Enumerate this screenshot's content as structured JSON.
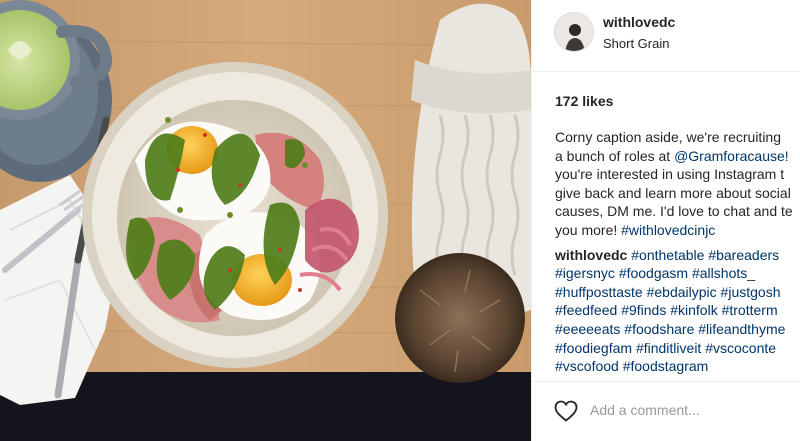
{
  "post": {
    "username": "withlovedc",
    "location": "Short Grain",
    "likes_text": "172 likes",
    "caption": {
      "l1": "Corny caption aside, we're recruiting",
      "l2a": "a bunch of roles at ",
      "l2_mention": "@Gramforacause!",
      "l3": "you're interested in using Instagram t",
      "l4": "give back and learn more about social",
      "l5": "causes, DM me. I'd love to chat and te",
      "l6a": "you more! ",
      "l6_tag": "#withlovedcinjc"
    },
    "comment": {
      "author": "withlovedc",
      "tags": [
        "#onthetable",
        "#bareaders",
        "#igersnyc",
        "#foodgasm",
        "#allshots_",
        "#huffposttaste",
        "#ebdailypic",
        "#justgosh",
        "#feedfeed",
        "#9finds",
        "#kinfolk",
        "#trotterm",
        "#eeeeeats",
        "#foodshare",
        "#lifeandthyme",
        "#foodiegfam",
        "#finditliveit",
        "#vscoconte",
        "#vscofood",
        "#foodstagram"
      ]
    },
    "add_comment_placeholder": "Add a comment..."
  },
  "colors": {
    "link": "#003569",
    "text": "#262626",
    "placeholder": "#999999"
  },
  "icons": {
    "like": "heart-outline-icon"
  }
}
